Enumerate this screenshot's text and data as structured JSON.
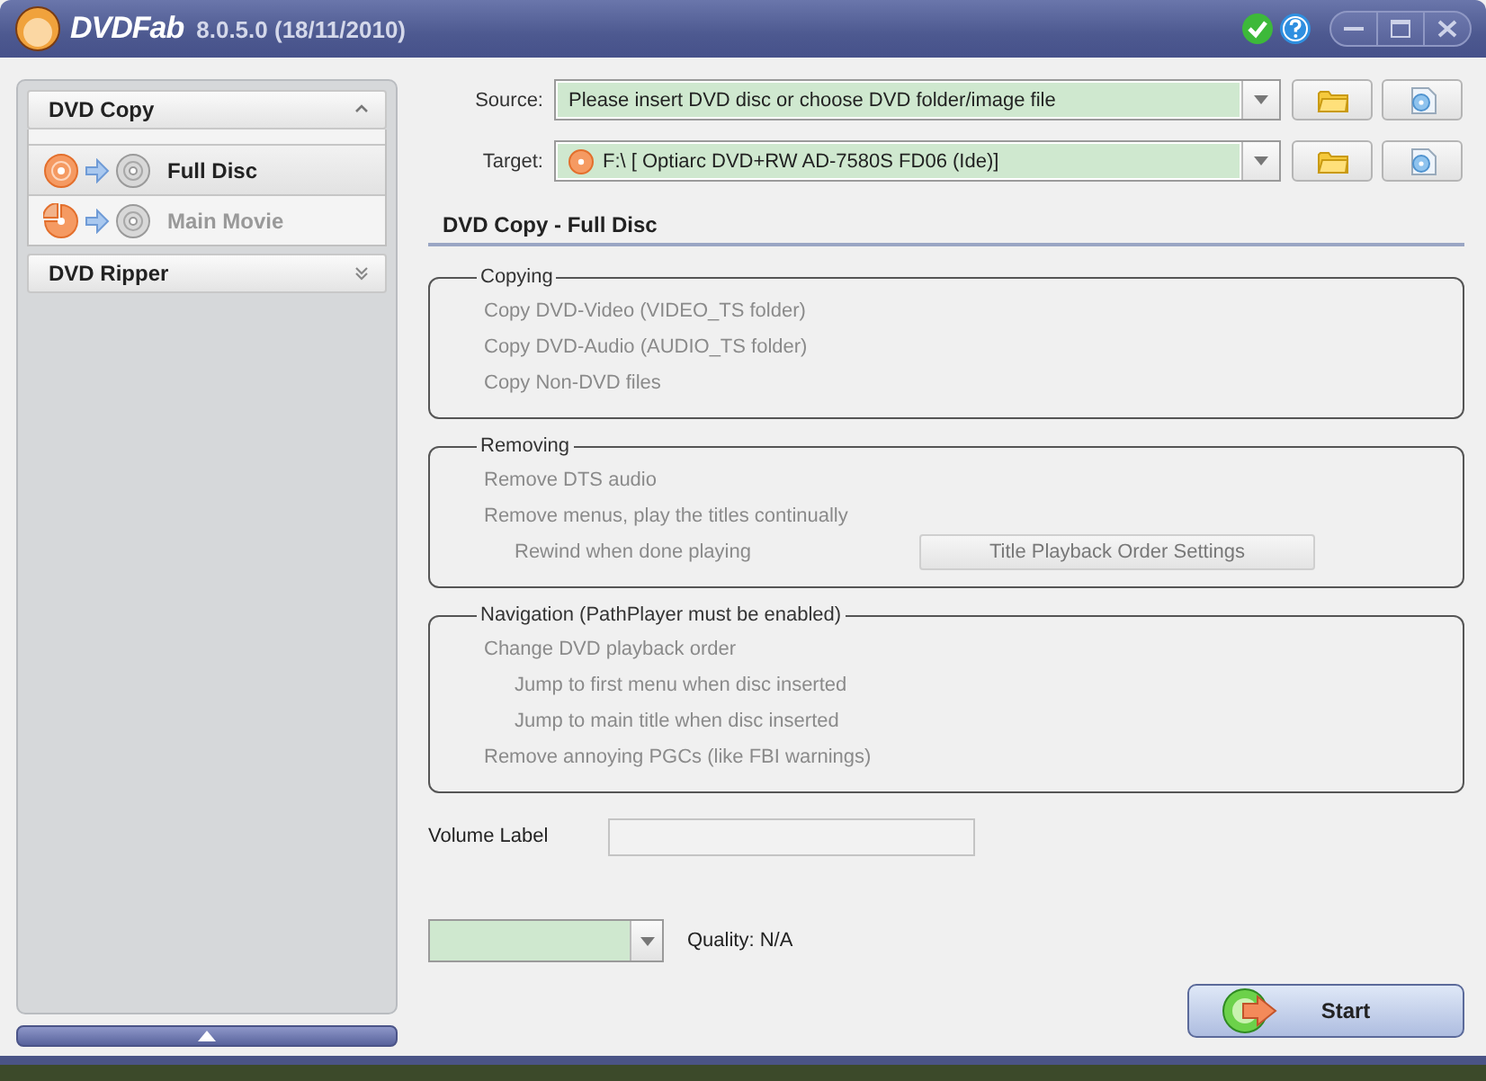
{
  "window": {
    "logo": "DVDFab",
    "version": "8.0.5.0 (18/11/2010)"
  },
  "sidebar": {
    "sections": [
      {
        "label": "DVD Copy",
        "expanded": true,
        "items": [
          {
            "label": "Full Disc",
            "kind": "full",
            "selected": true
          },
          {
            "label": "Main Movie",
            "kind": "main",
            "selected": false
          }
        ]
      },
      {
        "label": "DVD Ripper",
        "expanded": false
      }
    ]
  },
  "source": {
    "label": "Source:",
    "value": "Please insert DVD disc or choose DVD folder/image file"
  },
  "target": {
    "label": "Target:",
    "value": "F:\\ [ Optiarc DVD+RW AD-7580S FD06 (Ide)]"
  },
  "section_title": "DVD Copy - Full Disc",
  "groups": [
    {
      "title": "Copying",
      "options": [
        {
          "label": "Copy DVD-Video (VIDEO_TS folder)",
          "disabled": true
        },
        {
          "label": "Copy DVD-Audio (AUDIO_TS folder)",
          "disabled": true
        },
        {
          "label": "Copy Non-DVD files",
          "disabled": true
        }
      ]
    },
    {
      "title": "Removing",
      "options": [
        {
          "label": "Remove DTS audio",
          "disabled": true
        },
        {
          "label": "Remove menus, play the titles continually",
          "disabled": true,
          "children": [
            {
              "label": "Rewind when done playing",
              "disabled": true,
              "button": {
                "label": "Title Playback Order Settings",
                "disabled": true
              }
            }
          ]
        }
      ]
    },
    {
      "title": "Navigation (PathPlayer must be enabled)",
      "options": [
        {
          "label": "Change DVD playback order",
          "disabled": true,
          "children": [
            {
              "label": "Jump to first menu when disc inserted",
              "disabled": true
            },
            {
              "label": "Jump to main title when disc inserted",
              "disabled": true
            }
          ]
        },
        {
          "label": "Remove annoying PGCs (like FBI warnings)",
          "disabled": true
        }
      ]
    }
  ],
  "volume_label": {
    "label": "Volume Label"
  },
  "quality": {
    "label": "Quality: N/A"
  },
  "start_button": {
    "label": "Start"
  }
}
